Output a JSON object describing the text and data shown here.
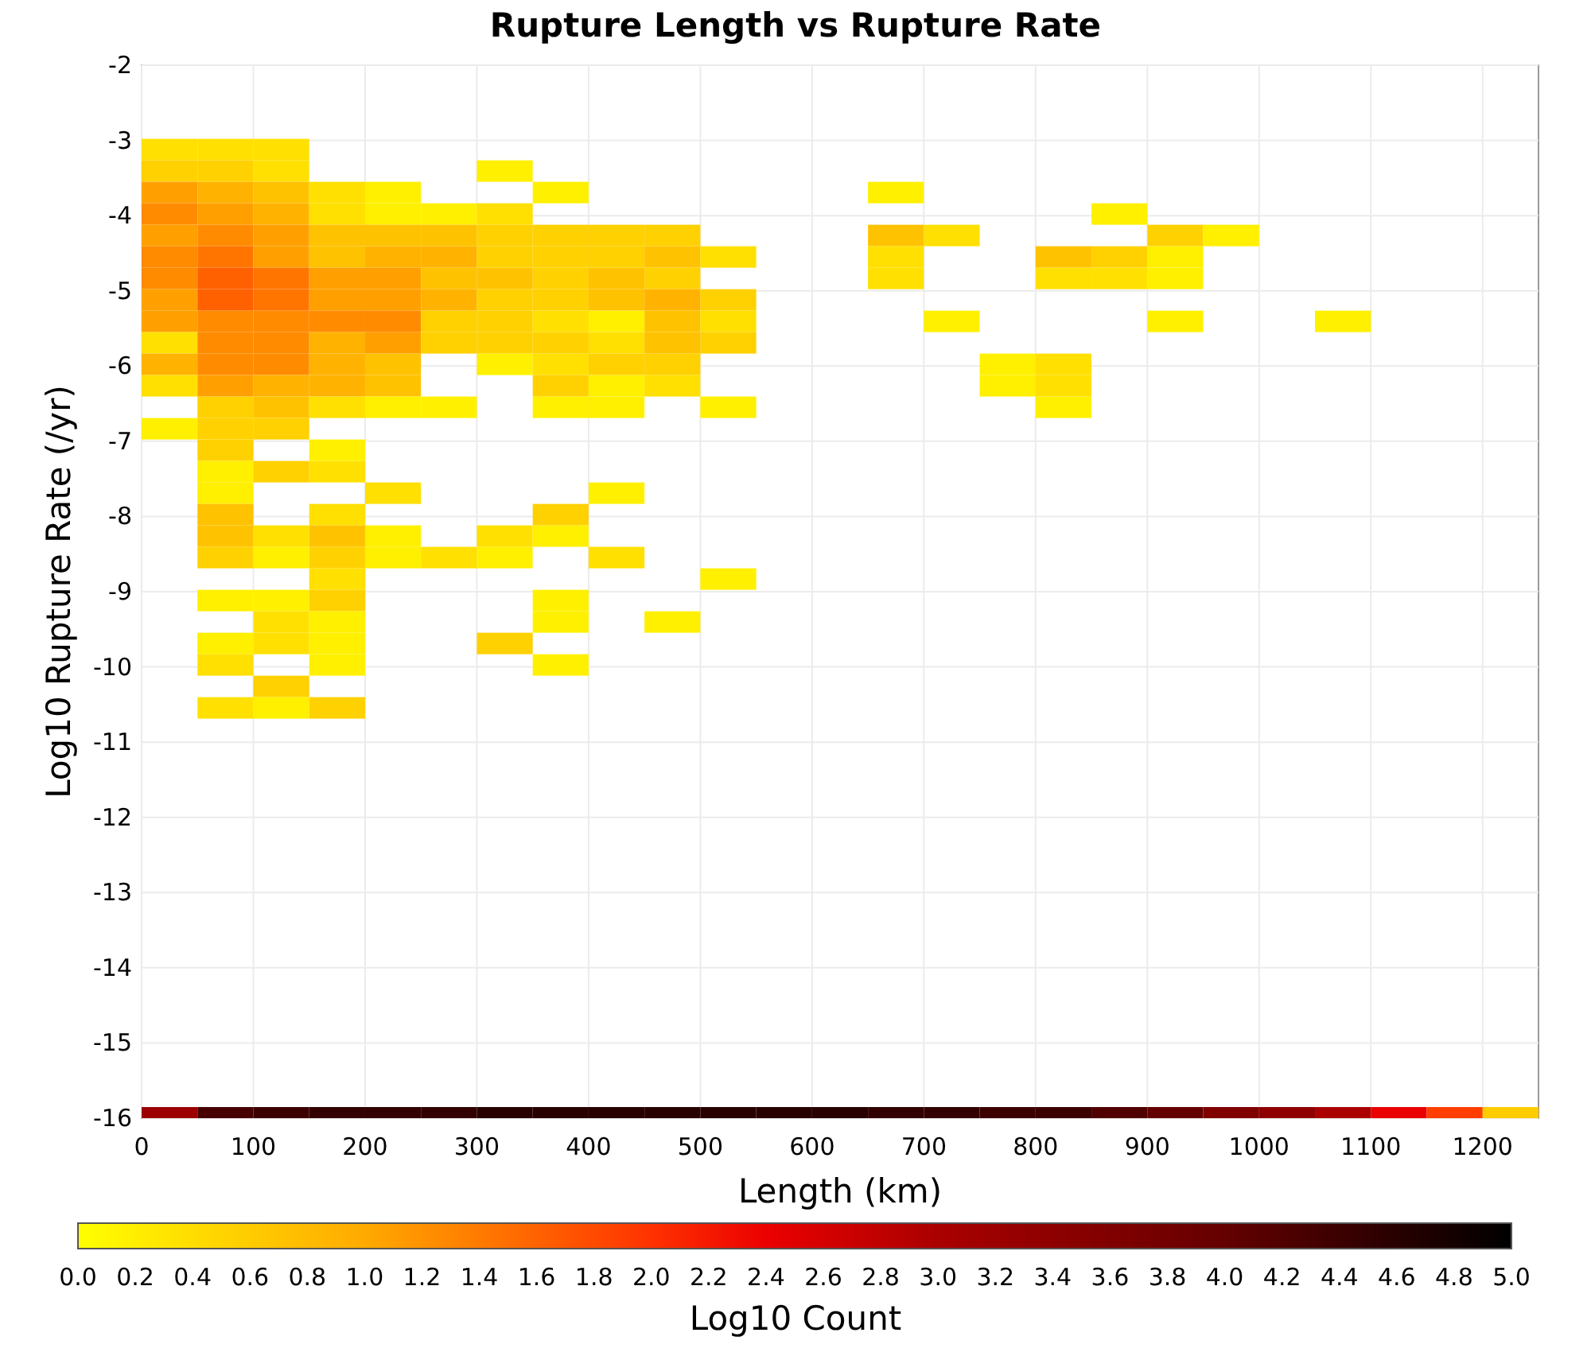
{
  "chart": {
    "title": "Rupture Length vs Rupture Rate",
    "xlabel": "Length (km)",
    "ylabel": "Log10 Rupture Rate (/yr)",
    "xticks": [
      "0",
      "100",
      "200",
      "300",
      "400",
      "500",
      "600",
      "700",
      "800",
      "900",
      "1000",
      "1100",
      "1200"
    ],
    "yticks": [
      "-2",
      "-3",
      "-4",
      "-5",
      "-6",
      "-7",
      "-8",
      "-9",
      "-10",
      "-11",
      "-12",
      "-13",
      "-14",
      "-15",
      "-16"
    ]
  },
  "colorbar": {
    "label": "Log10 Count",
    "ticks": [
      "0.0",
      "0.2",
      "0.4",
      "0.6",
      "0.8",
      "1.0",
      "1.2",
      "1.4",
      "1.6",
      "1.8",
      "2.0",
      "2.2",
      "2.4",
      "2.6",
      "2.8",
      "3.0",
      "3.2",
      "3.4",
      "3.6",
      "3.8",
      "4.0",
      "4.2",
      "4.4",
      "4.6",
      "4.8",
      "5.0"
    ]
  }
}
